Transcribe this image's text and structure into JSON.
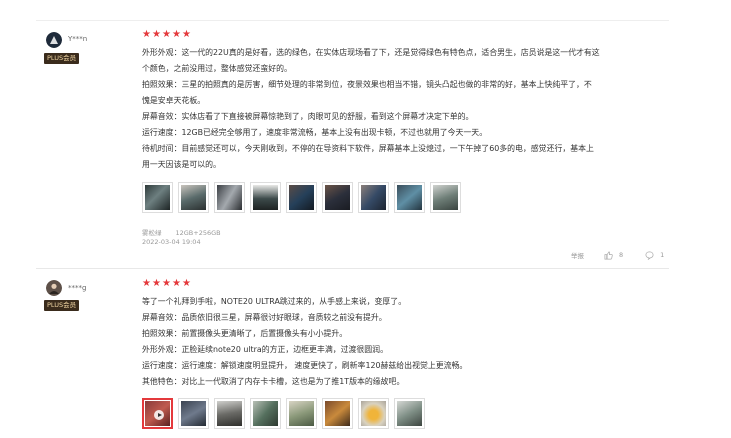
{
  "reviews": [
    {
      "username": "Y***n",
      "badge": "PLUS会员",
      "rating": 5,
      "lines": [
        "外形外观：这一代的22U真的是好看，选的绿色，在实体店现场看了下，还是觉得绿色有特色点，适合男生，店员说是这一代才有这",
        "个颜色，之前没用过，整体感觉还蛮好的。",
        "拍照效果：三星的拍照真的是厉害，细节处理的非常到位，夜景效果也相当不错，镜头凸起也做的非常的好，基本上快纯平了，不",
        "愧是安卓天花板。",
        "屏幕音效：实体店看了下直接被屏幕惊艳到了，肉眼可见的舒服，看到这个屏幕才决定下单的。",
        "运行速度：12GB已经完全够用了，速度非常流畅，基本上没有出现卡顿，不过也就用了今天一天。",
        "待机时间：目前感觉还可以，今天刚收到，不停的在导资料下软件，屏幕基本上没熄过，一下午掉了60多的电，感觉还行，基本上",
        "用一天因该是可以的。"
      ],
      "photo_count": 9,
      "variant": "雾松绿",
      "spec": "12GB+256GB",
      "date": "2022-03-04 19:04",
      "report": "举报",
      "likes": "8",
      "comments": "1"
    },
    {
      "username": "****g",
      "badge": "PLUS会员",
      "rating": 5,
      "lines": [
        "等了一个礼拜到手啦，NOTE20 ULTRA跳过来的，从手感上来说，变厚了。",
        "屏幕音效：品质依旧很三星，屏幕很讨好眼球，音质较之前没有提升。",
        "拍照效果：前置摄像头更清晰了，后置摄像头有小小提升。",
        "外形外观：正脸延续note20 ultra的方正，边框更丰满，过渡很圆润。",
        "运行速度：运行速度：解锁速度明显提升， 速度更快了，刷新率120赫兹给出视觉上更流畅。",
        "其他特色：对比上一代取消了内存卡卡槽，这也是为了推1T版本的缘故吧。"
      ],
      "photo_count": 8
    }
  ],
  "colors": {
    "star": "#e4393c",
    "badge_bg": "#3a2b1c",
    "badge_text": "#f4d9a6"
  },
  "icons": {
    "like": "thumbs-up-icon",
    "comment": "comment-bubble-icon",
    "play": "play-icon"
  }
}
